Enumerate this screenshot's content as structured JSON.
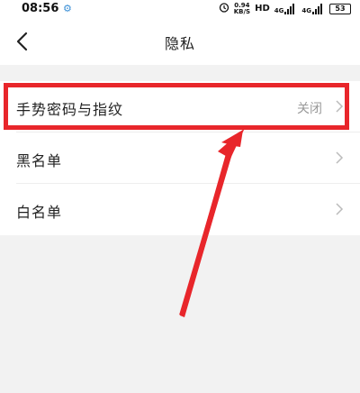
{
  "status_bar": {
    "time": "08:56",
    "notification": "⚙",
    "net_speed_value": "0.94",
    "net_speed_unit": "KB/S",
    "hd_label": "HD",
    "signal1_label": "4G",
    "signal2_label": "4G",
    "battery": "53"
  },
  "header": {
    "title": "隐私"
  },
  "settings": [
    {
      "label": "手势密码与指纹",
      "value": "关闭"
    },
    {
      "label": "黑名单",
      "value": ""
    },
    {
      "label": "白名单",
      "value": ""
    }
  ],
  "colors": {
    "highlight": "#e8262b",
    "background": "#f2f2f2",
    "row_background": "#ffffff",
    "secondary_text": "#999999"
  }
}
